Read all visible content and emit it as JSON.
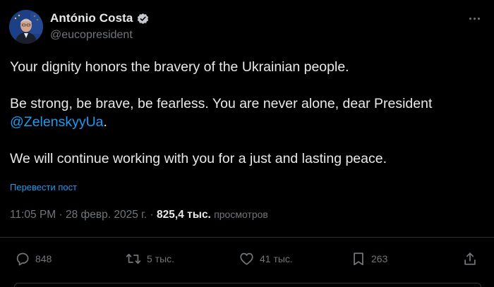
{
  "author": {
    "display_name": "António Costa",
    "handle": "@eucopresident",
    "verified": true
  },
  "post": {
    "paragraph_1": "Your dignity honors the bravery of the Ukrainian people.",
    "paragraph_2_text": "Be strong, be brave, be fearless. You are never alone, dear President ",
    "paragraph_2_mention": "@ZelenskyyUa",
    "paragraph_2_end": ".",
    "paragraph_3": "We will continue working with you for a just and lasting peace.",
    "translate_label": "Перевести пост"
  },
  "meta": {
    "time": "11:05 PM",
    "separator": " · ",
    "date": "28 февр. 2025 г.",
    "views_count": "825,4 тыс.",
    "views_label": "просмотров"
  },
  "actions": {
    "replies": "848",
    "reposts": "5 тыс.",
    "likes": "41 тыс.",
    "bookmarks": "263"
  },
  "colors": {
    "background": "#000000",
    "text": "#e7e9ea",
    "secondary": "#71767b",
    "accent": "#1d9bf0",
    "divider": "#2f3336"
  },
  "icons": {
    "avatar": "profile-photo",
    "verified": "verified-badge-icon",
    "more": "more-dots-icon",
    "reply": "reply-icon",
    "repost": "repost-icon",
    "like": "heart-icon",
    "bookmark": "bookmark-icon",
    "share": "share-icon"
  }
}
